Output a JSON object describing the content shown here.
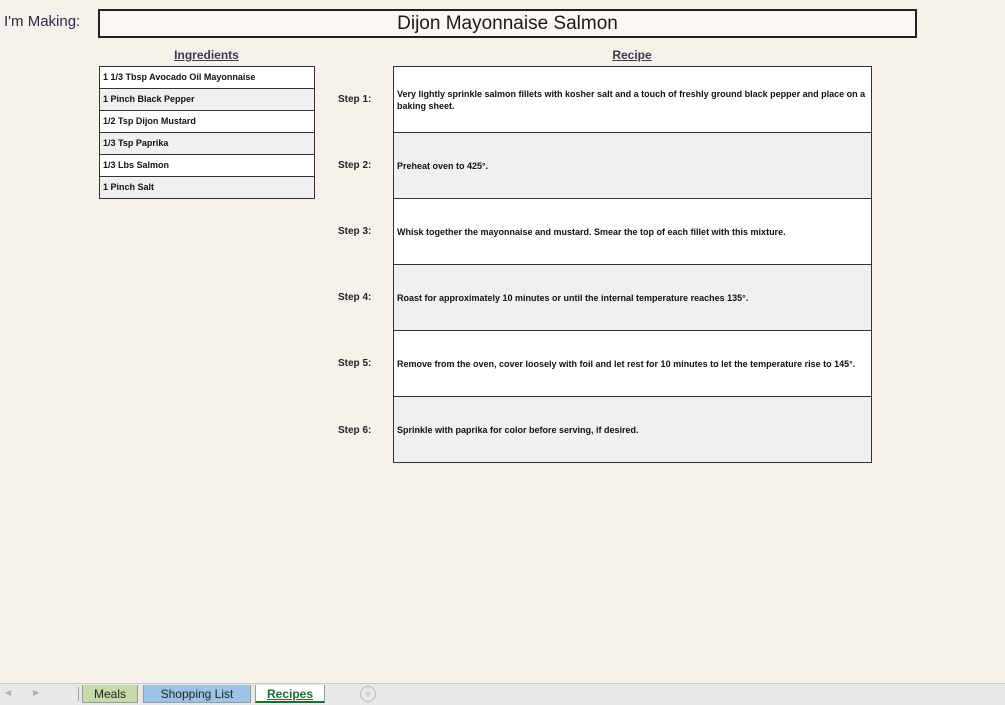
{
  "header": {
    "making_label": "I'm Making:",
    "dish_title": "Dijon Mayonnaise Salmon"
  },
  "ingredients": {
    "header": "Ingredients",
    "items": [
      "1 1/3 Tbsp Avocado Oil Mayonnaise",
      "1 Pinch Black Pepper",
      "1/2 Tsp Dijon Mustard",
      "1/3 Tsp Paprika",
      "1/3 Lbs Salmon",
      "1 Pinch Salt"
    ]
  },
  "recipe": {
    "header": "Recipe",
    "steps": [
      {
        "label": "Step 1:",
        "text": "Very lightly sprinkle salmon fillets with kosher salt and a touch of freshly ground black pepper and place on a baking sheet."
      },
      {
        "label": "Step 2:",
        "text": "Preheat oven to 425°."
      },
      {
        "label": "Step 3:",
        "text": "Whisk together the mayonnaise and mustard. Smear the top of each fillet with this mixture."
      },
      {
        "label": "Step 4:",
        "text": "Roast for approximately 10 minutes or until the internal temperature reaches 135°."
      },
      {
        "label": "Step 5:",
        "text": "Remove from the oven, cover loosely with foil and let rest for 10 minutes to let the temperature rise to 145°."
      },
      {
        "label": "Step 6:",
        "text": "Sprinkle with paprika for color before serving, if desired."
      }
    ]
  },
  "tabs": {
    "prev_icon": "chevron-left-icon",
    "next_icon": "chevron-right-icon",
    "items": [
      "Meals",
      "Shopping List",
      "Recipes"
    ],
    "active": "Recipes",
    "add_icon": "plus-circle-icon",
    "add_glyph": "+",
    "prev_glyph": "◀",
    "next_glyph": "▶"
  },
  "colors": {
    "sheet_background": "#f7f1eb",
    "meals_tab": "#c4dba9",
    "shopping_tab": "#9dc3e6",
    "active_tab_text": "#1e6b2f"
  }
}
